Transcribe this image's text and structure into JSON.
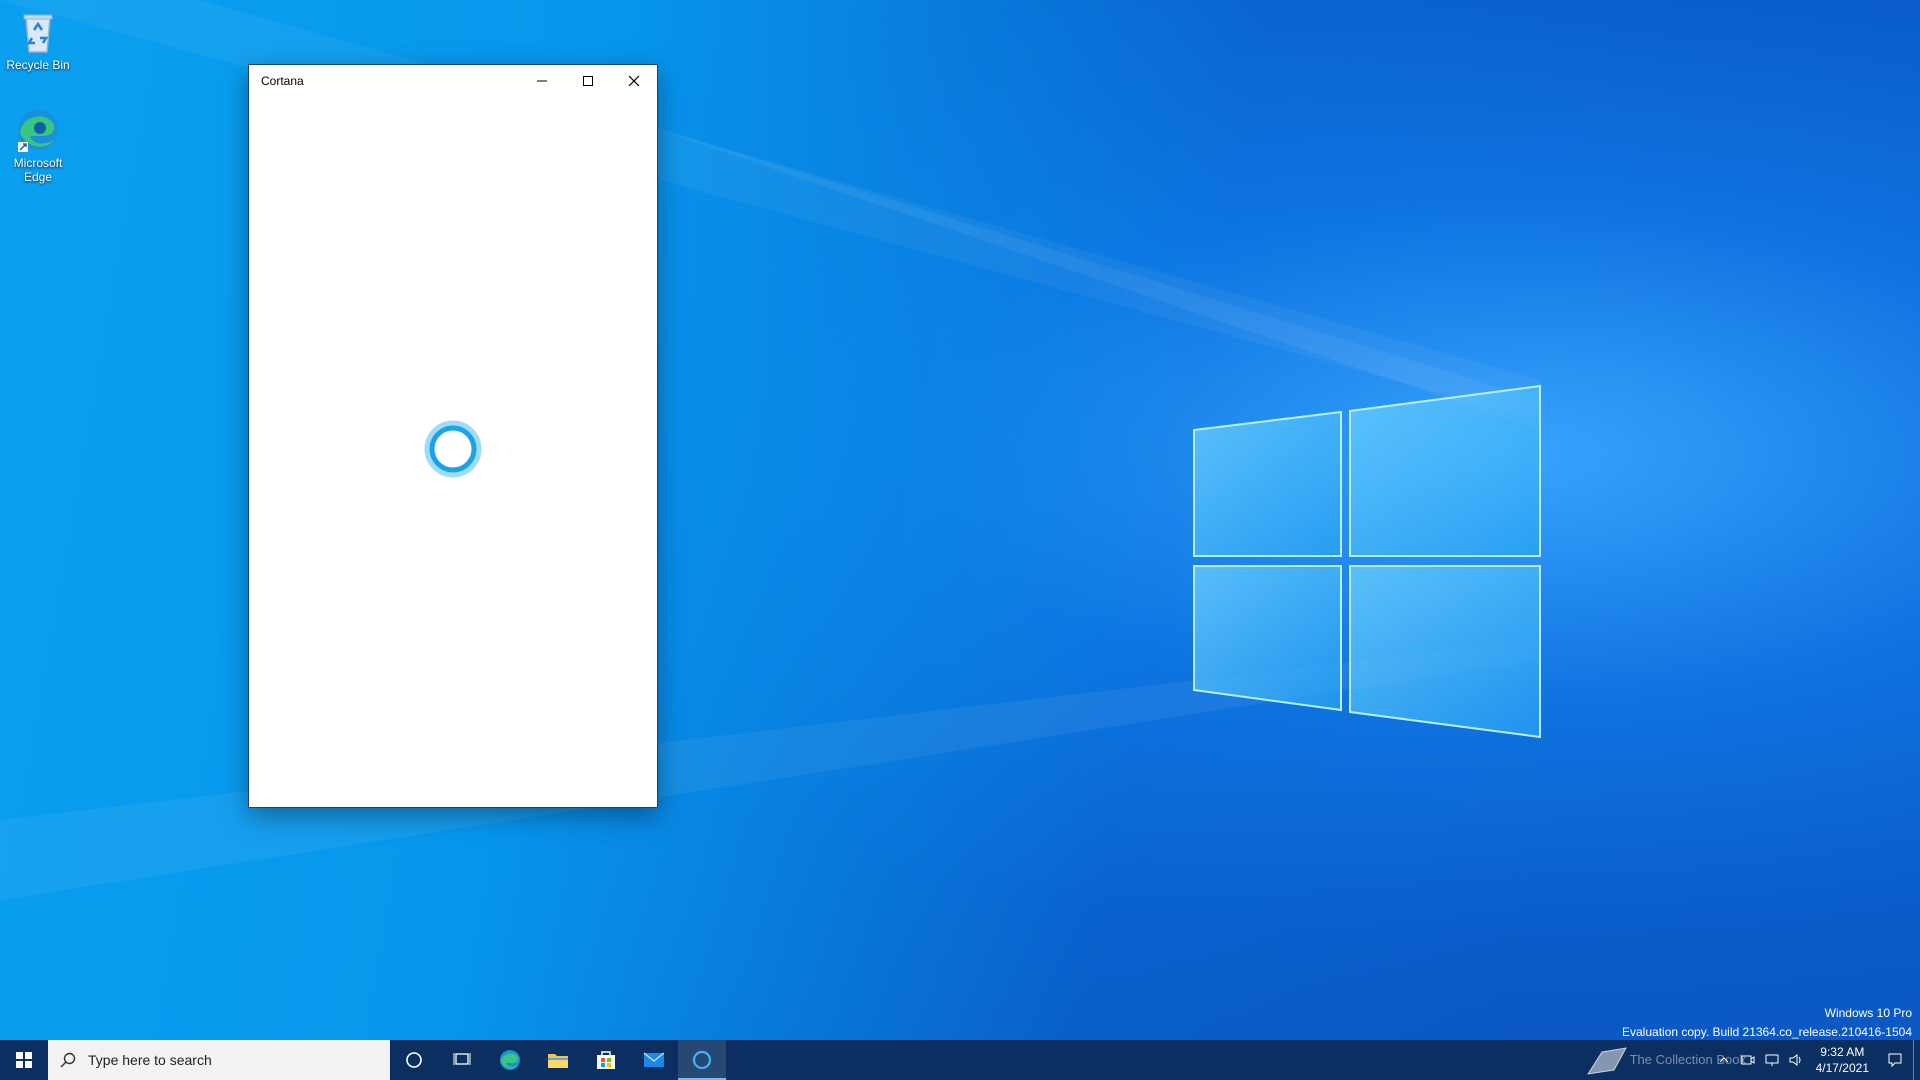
{
  "desktop": {
    "icons": [
      {
        "label": "Recycle Bin",
        "icon": "recycle-bin-icon"
      },
      {
        "label": "Microsoft Edge",
        "icon": "edge-icon"
      }
    ],
    "watermark": {
      "line1": "Windows 10 Pro",
      "line2": "Evaluation copy. Build 21364.co_release.210416-1504",
      "overlay": "The Collection Book"
    }
  },
  "window": {
    "title": "Cortana",
    "buttons": {
      "minimize": "minimize-icon",
      "maximize": "maximize-icon",
      "close": "close-icon"
    },
    "content": {
      "indicator": "cortana-ring-icon"
    }
  },
  "taskbar": {
    "search": {
      "placeholder": "Type here to search"
    },
    "pinned": [
      "cortana-icon",
      "task-view-icon",
      "edge-icon",
      "file-explorer-icon",
      "store-icon",
      "mail-icon",
      "cortana-app-icon"
    ],
    "clock": {
      "time": "9:32 AM",
      "date": "4/17/2021"
    }
  },
  "colors": {
    "taskbar": "#0b2f61",
    "accent": "#76b9ed",
    "cortana": "#1aa3e8"
  }
}
